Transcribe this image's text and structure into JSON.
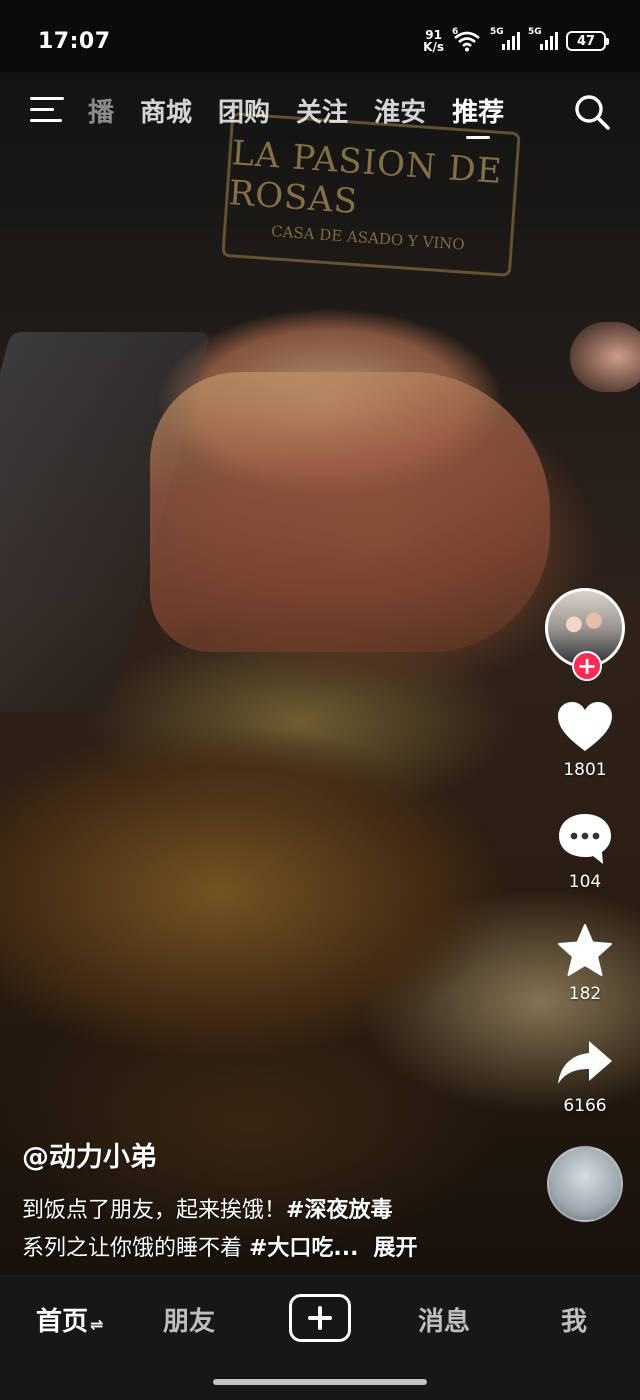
{
  "status_bar": {
    "time": "17:07",
    "net_speed_value": "91",
    "net_speed_unit": "K/s",
    "sim1_label": "5G",
    "sim2_label": "5G",
    "wifi_label": "6",
    "battery": "47"
  },
  "video": {
    "sign_line1": "LA PASION DE ROSAS",
    "sign_line2": "CASA DE ASADO Y VINO"
  },
  "top_nav": {
    "tabs": [
      {
        "label": "播",
        "state": "clipped"
      },
      {
        "label": "商城"
      },
      {
        "label": "团购"
      },
      {
        "label": "关注"
      },
      {
        "label": "淮安"
      },
      {
        "label": "推荐",
        "active": true
      }
    ]
  },
  "rail": {
    "likes": "1801",
    "comments": "104",
    "favorites": "182",
    "shares": "6166",
    "follow_symbol": "+"
  },
  "caption": {
    "author": "@动力小弟",
    "text_prefix": "到饭点了朋友，起来挨饿！",
    "hashtag1": "#深夜放毒",
    "text_line2": "系列之让你饿的睡不着 ",
    "hashtag2": "#大口吃...",
    "expand": "展开"
  },
  "bottom_nav": {
    "home": "首页",
    "home_switch": "⇌",
    "friends": "朋友",
    "messages": "消息",
    "me": "我"
  },
  "colors": {
    "follow_badge": "#fe2c55",
    "bottom_bar": "#171717"
  }
}
